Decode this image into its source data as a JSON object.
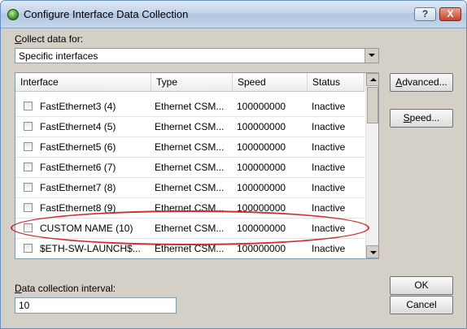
{
  "window": {
    "title": "Configure Interface Data Collection",
    "help_glyph": "?",
    "close_glyph": "X"
  },
  "collect": {
    "label_first": "C",
    "label_rest": "ollect data for:",
    "selected": "Specific interfaces"
  },
  "table": {
    "columns": [
      "Interface",
      "Type",
      "Speed",
      "Status"
    ],
    "rows": [
      {
        "interface": "FastEthernet3 (4)",
        "type": "Ethernet CSM...",
        "speed": "100000000",
        "status": "Inactive"
      },
      {
        "interface": "FastEthernet4 (5)",
        "type": "Ethernet CSM...",
        "speed": "100000000",
        "status": "Inactive"
      },
      {
        "interface": "FastEthernet5 (6)",
        "type": "Ethernet CSM...",
        "speed": "100000000",
        "status": "Inactive"
      },
      {
        "interface": "FastEthernet6 (7)",
        "type": "Ethernet CSM...",
        "speed": "100000000",
        "status": "Inactive"
      },
      {
        "interface": "FastEthernet7 (8)",
        "type": "Ethernet CSM...",
        "speed": "100000000",
        "status": "Inactive"
      },
      {
        "interface": "FastEthernet8 (9)",
        "type": "Ethernet CSM...",
        "speed": "100000000",
        "status": "Inactive"
      },
      {
        "interface": "CUSTOM NAME (10)",
        "type": "Ethernet CSM...",
        "speed": "100000000",
        "status": "Inactive"
      },
      {
        "interface": "$ETH-SW-LAUNCH$...",
        "type": "Ethernet CSM...",
        "speed": "100000000",
        "status": "Inactive"
      }
    ]
  },
  "buttons": {
    "advanced_first": "A",
    "advanced_rest": "dvanced...",
    "speed_first": "S",
    "speed_rest": "peed...",
    "ok": "OK",
    "cancel": "Cancel"
  },
  "interval": {
    "label_first": "D",
    "label_rest": "ata collection interval:",
    "value": "10"
  },
  "colors": {
    "highlight": "#d42d2d",
    "window_bg": "#d4d0c8"
  }
}
